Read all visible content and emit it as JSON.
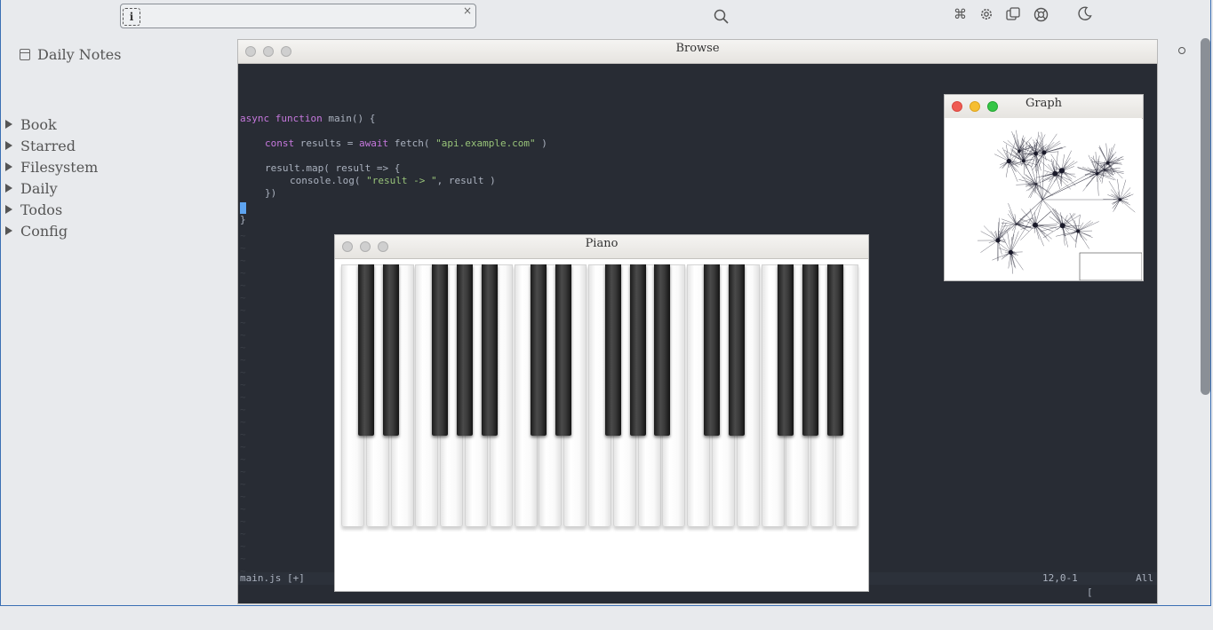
{
  "sidebar": {
    "daily_notes": "Daily Notes",
    "items": [
      {
        "label": "Book"
      },
      {
        "label": "Starred"
      },
      {
        "label": "Filesystem"
      },
      {
        "label": "Daily"
      },
      {
        "label": "Todos"
      },
      {
        "label": "Config"
      }
    ]
  },
  "search": {
    "placeholder": "",
    "clear": "×",
    "info_glyph": "i"
  },
  "toolbar": {
    "icons": [
      "search-icon",
      "command-icon",
      "settings-gear-icon",
      "copy-windows-icon",
      "help-lifebuoy-icon",
      "dark-mode-moon-icon"
    ]
  },
  "browse_window": {
    "title": "Browse",
    "code": {
      "line1_kw": "async function",
      "line1_rest": " main() {",
      "line2_kw1": "const",
      "line2_mid": " results = ",
      "line2_kw2": "await",
      "line2_fn": " fetch( ",
      "line2_str": "\"api.example.com\"",
      "line2_end": " )",
      "line3": "result.map( result => {",
      "line4_pre": "console.log( ",
      "line4_str": "\"result -> \"",
      "line4_end": ", result )",
      "line5": "})",
      "line6": "}"
    },
    "tilde": "~",
    "status": {
      "file": "main.js [+]",
      "position": "12,0-1",
      "scroll": "All"
    },
    "cmdline": "["
  },
  "piano_window": {
    "title": "Piano"
  },
  "graph_window": {
    "title": "Graph"
  },
  "colors": {
    "accent": "#5ea4f0",
    "editor_bg": "#282c34",
    "keyword": "#c678dd",
    "string": "#98c379"
  }
}
